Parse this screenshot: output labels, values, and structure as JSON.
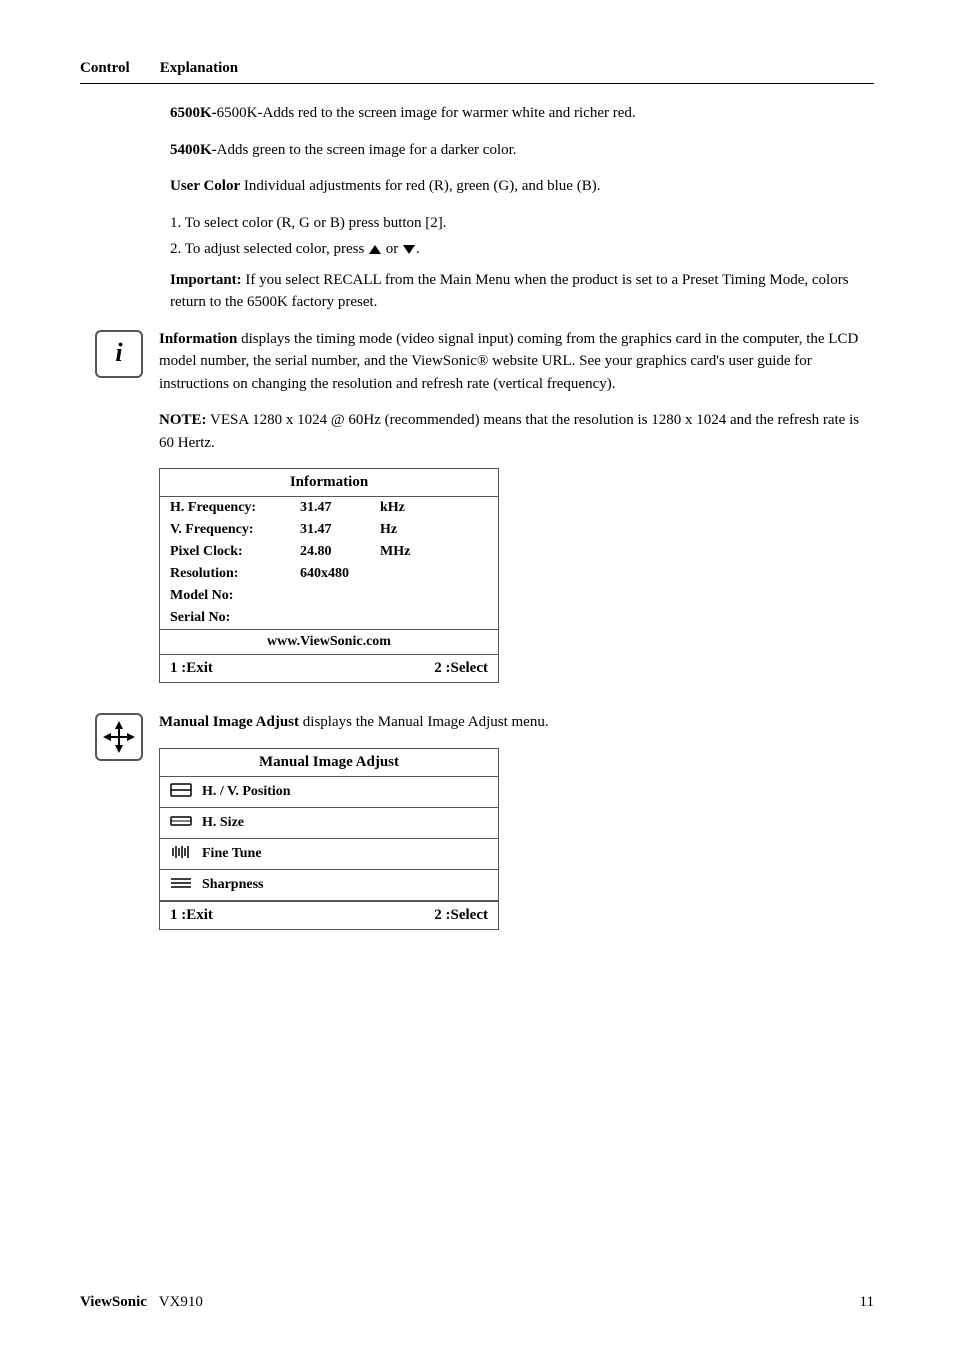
{
  "header": {
    "control_label": "Control",
    "explanation_label": "Explanation"
  },
  "content": {
    "para_6500k": "6500K-Adds red to the screen image for warmer white and richer red.",
    "para_5400k": "5400K-Adds green to the screen image for a darker color.",
    "user_color_bold": "User Color",
    "user_color_rest": " Individual adjustments for red (R), green (G),  and blue (B).",
    "step1": "1.  To select color (R, G or B) press button [2].",
    "step2_pre": "2.  To adjust selected color, press",
    "step2_post": "or",
    "important_bold": "Important:",
    "important_rest": " If you select RECALL from the Main Menu when the product is set to a Preset Timing Mode, colors return to the 6500K factory preset.",
    "info_bold": "Information",
    "info_rest": " displays the timing mode (video signal input) coming from the graphics card in the computer, the LCD model number, the serial number, and the ViewSonic® website URL. See your graphics card's user guide for instructions on changing the resolution and refresh rate (vertical frequency).",
    "note_bold": "NOTE:",
    "note_rest": " VESA 1280 x 1024 @ 60Hz (recommended) means that the resolution is 1280 x 1024 and the refresh rate is 60 Hertz.",
    "info_table": {
      "title": "Information",
      "rows": [
        {
          "label": "H. Frequency:",
          "value": "31.47",
          "unit": "kHz"
        },
        {
          "label": "V. Frequency:",
          "value": "31.47",
          "unit": "Hz"
        },
        {
          "label": "Pixel Clock:",
          "value": "24.80",
          "unit": "MHz"
        },
        {
          "label": "Resolution:",
          "value": "640x480",
          "unit": ""
        },
        {
          "label": "Model No:",
          "value": "",
          "unit": ""
        },
        {
          "label": "Serial No:",
          "value": "",
          "unit": ""
        }
      ],
      "website": "www.ViewSonic.com",
      "exit_label": "1 :Exit",
      "select_label": "2 :Select"
    },
    "manual_bold": "Manual Image Adjust",
    "manual_rest": " displays the Manual Image Adjust menu.",
    "manual_table": {
      "title": "Manual Image Adjust",
      "items": [
        {
          "icon": "hv_position",
          "label": "H. / V. Position"
        },
        {
          "icon": "h_size",
          "label": "H. Size"
        },
        {
          "icon": "fine_tune",
          "label": "Fine Tune"
        },
        {
          "icon": "sharpness",
          "label": "Sharpness"
        }
      ],
      "exit_label": "1 :Exit",
      "select_label": "2 :Select"
    }
  },
  "footer": {
    "brand": "ViewSonic",
    "model": "VX910",
    "page": "11"
  }
}
